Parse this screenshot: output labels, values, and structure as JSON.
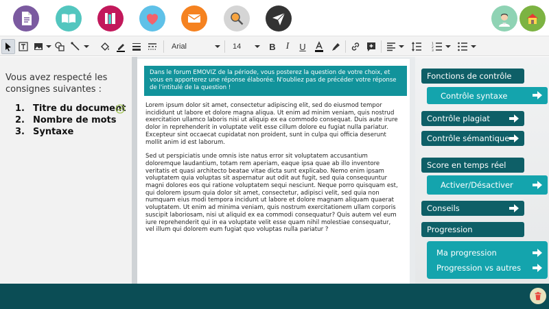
{
  "toolbar": {
    "font": "Arial",
    "size": "14"
  },
  "left": {
    "intro": "Vous avez respecté les consignes suivantes :",
    "criteria": [
      {
        "num": "1.",
        "label": "Titre du document"
      },
      {
        "num": "2.",
        "label": "Nombre de mots"
      },
      {
        "num": "3.",
        "label": "Syntaxe"
      }
    ]
  },
  "editor": {
    "prompt": "Dans le forum EMOVIZ de la période, vous posterez la question de votre choix, et vous en apporterez une réponse élaborée. N'oubliez pas de précéder votre réponse de l'intitulé de la question !",
    "paragraph1": "Lorem ipsum dolor sit amet, consectetur adipiscing elit, sed do eiusmod tempor incididunt ut labore et dolore magna aliqua. Ut enim ad minim veniam, quis nostrud exercitation ullamco laboris nisi ut aliquip ex ea commodo consequat. Duis aute irure dolor in reprehenderit in voluptate velit esse cillum dolore eu fugiat nulla pariatur. Excepteur sint occaecat cupidatat non proident, sunt in culpa qui officia deserunt mollit anim id est laborum.",
    "paragraph2": "Sed ut perspiciatis unde omnis iste natus error sit voluptatem accusantium doloremque laudantium, totam rem aperiam, eaque ipsa quae ab illo inventore veritatis et quasi architecto beatae vitae dicta sunt explicabo. Nemo enim ipsam voluptatem quia voluptas sit aspernatur aut odit aut fugit, sed quia consequuntur magni dolores eos qui ratione voluptatem sequi nesciunt. Neque porro quisquam est, qui dolorem ipsum quia dolor sit amet, consectetur, adipisci velit, sed quia non numquam eius modi tempora incidunt ut labore et dolore magnam aliquam quaerat voluptatem. Ut enim ad minima veniam, quis nostrum exercitationem ullam corporis suscipit laboriosam, nisi ut aliquid ex ea commodi consequatur? Quis autem vel eum iure reprehenderit qui in ea voluptate velit esse quam nihil molestiae consequatur, vel illum qui dolorem eum fugiat quo voluptas nulla pariatur ?"
  },
  "right": {
    "fonctions": "Fonctions de contrôle",
    "controle_syntaxe": "Contrôle syntaxe",
    "controle_plagiat": "Contrôle plagiat",
    "controle_semantique": "Contrôle sémantique",
    "score": "Score en temps réel",
    "activer": "Activer/Désactiver",
    "conseils": "Conseils",
    "progression": "Progression",
    "ma_progression": "Ma progression",
    "progression_vs": "Progression vs autres"
  },
  "colors": {
    "dark_teal": "#0e5f67",
    "light_teal": "#14a4ad",
    "prompt_teal": "#12939b",
    "bottom_bar": "#0b4d55"
  }
}
